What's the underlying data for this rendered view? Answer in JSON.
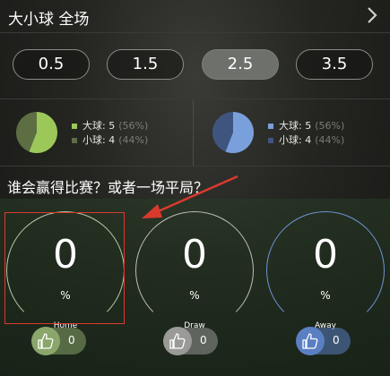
{
  "header": {
    "title": "大小球 全场",
    "chevron_icon": "chevron-right-icon"
  },
  "lines": [
    {
      "label": "0.5",
      "active": false
    },
    {
      "label": "1.5",
      "active": false
    },
    {
      "label": "2.5",
      "active": true
    },
    {
      "label": "3.5",
      "active": false
    }
  ],
  "pies": [
    {
      "over_label": "大球: 5",
      "over_pct": "(56%)",
      "under_label": "小球: 4",
      "under_pct": "(44%)",
      "over_color": "#9cc85a",
      "under_color": "#5d6e43",
      "over_fraction": 0.56
    },
    {
      "over_label": "大球: 5",
      "over_pct": "(56%)",
      "under_label": "小球: 4",
      "under_pct": "(44%)",
      "over_color": "#7aa0dc",
      "under_color": "#3f5580",
      "over_fraction": 0.56
    }
  ],
  "question": "谁会赢得比赛？或者一场平局？",
  "outcomes": [
    {
      "value": "0",
      "unit": "%",
      "label": "Home",
      "votes": "0",
      "color": "#8aa66a",
      "ring": "#b9c9a3"
    },
    {
      "value": "0",
      "unit": "%",
      "label": "Draw",
      "votes": "0",
      "color": "#9a9a98",
      "ring": "#bdbdb8"
    },
    {
      "value": "0",
      "unit": "%",
      "label": "Away",
      "votes": "0",
      "color": "#5a7fc3",
      "ring": "#6f93d6"
    }
  ],
  "annotation_color": "#d93a2e"
}
